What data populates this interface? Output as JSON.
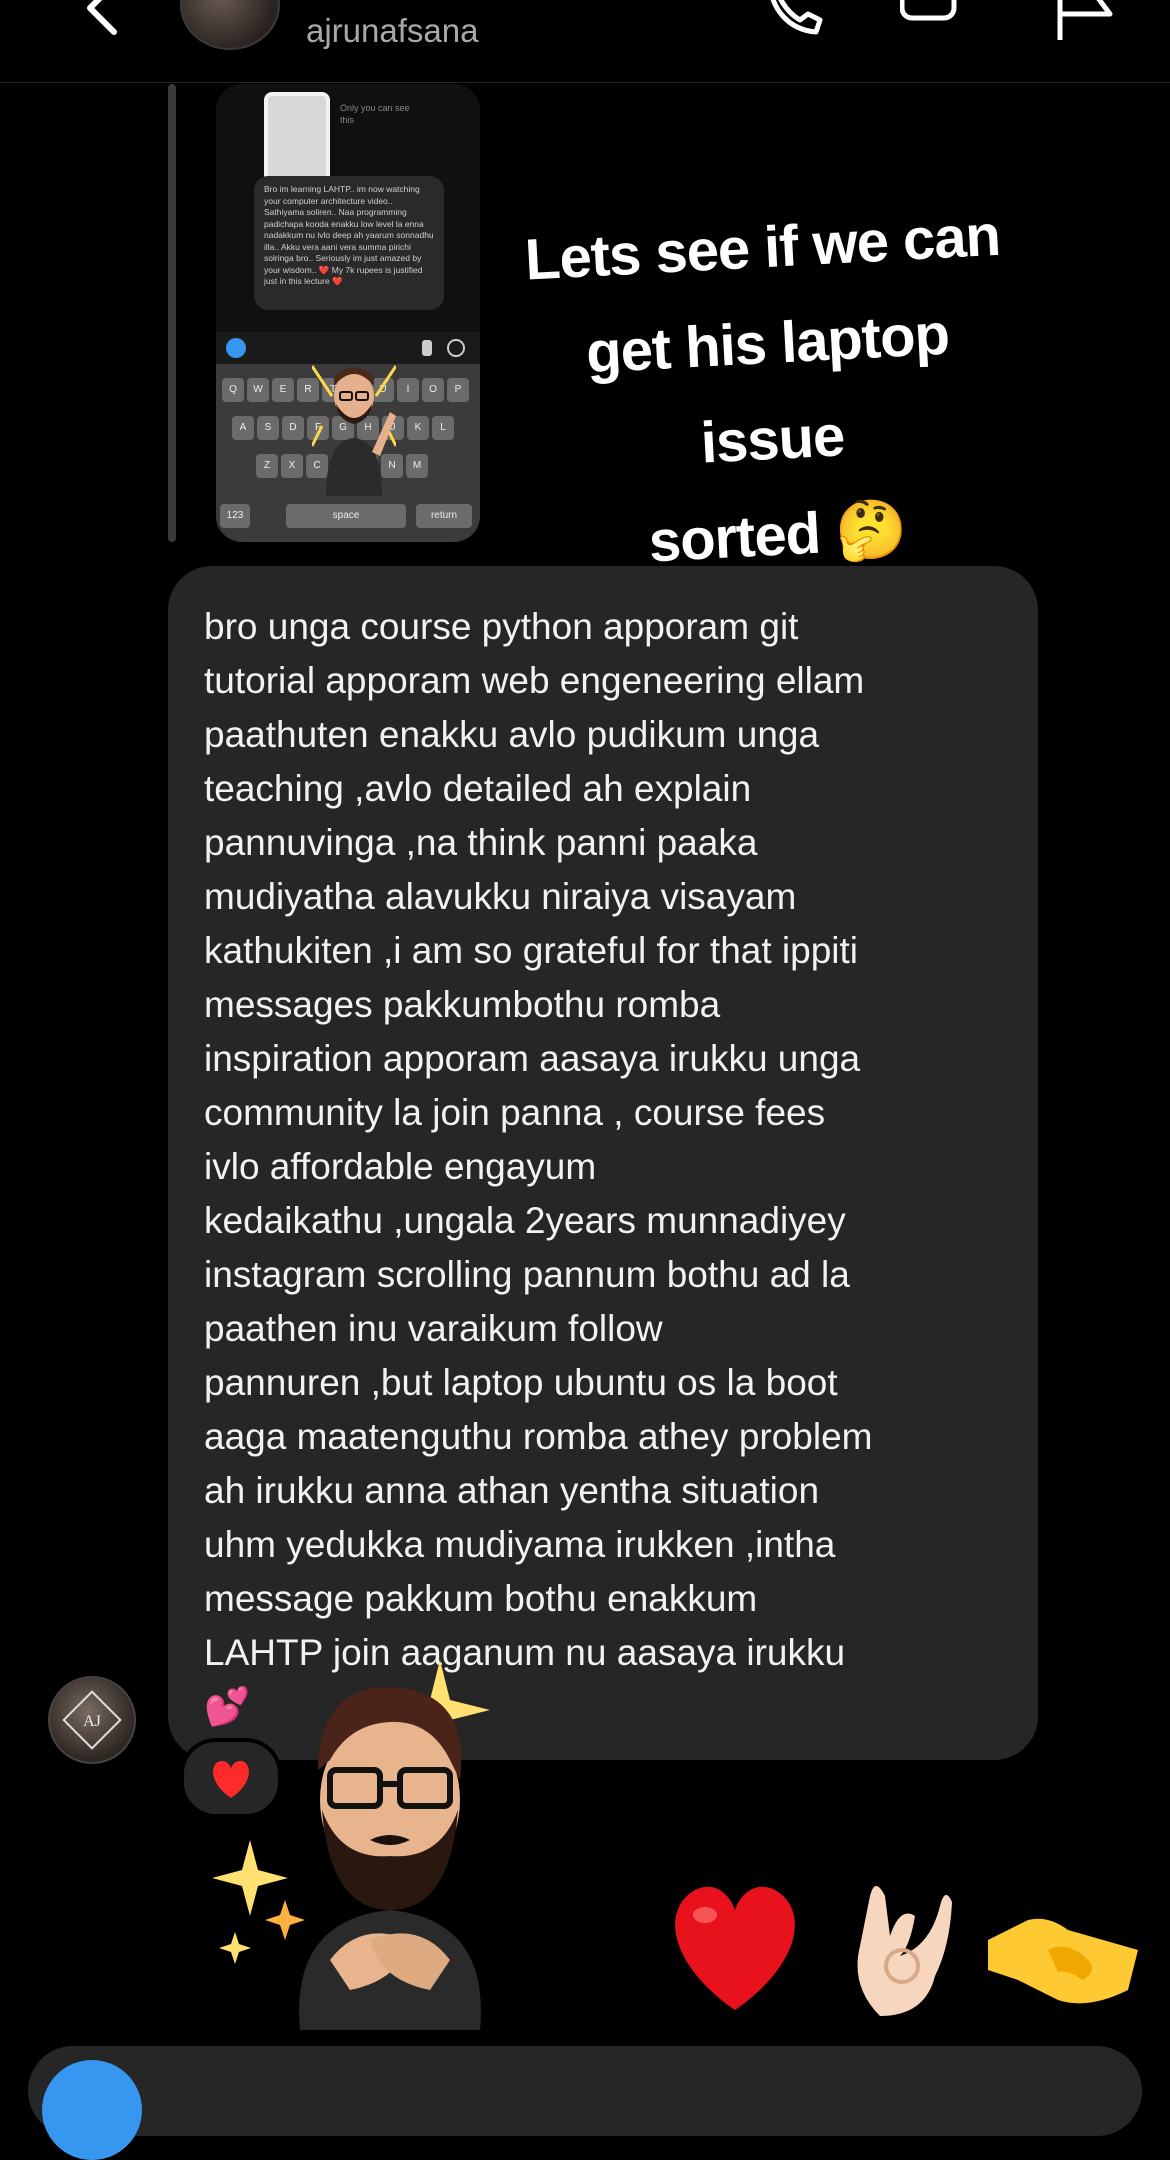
{
  "header": {
    "username": "ajrunafsana"
  },
  "story_reply": {
    "thumbnail": {
      "small_text": "Only you can see this",
      "quoted_message": "Bro im learning LAHTP.. im now watching your computer architecture video.. Sathiyama soliren.. Naa programming padichapa kooda enakku low level la enna nadakkum nu ivlo deep ah yaarum sonnadhu illa.. Akku vera aani vera summa pirichi solringa bro.. Seriously im just amazed by your wisdom.. ❤️ My 7k rupees is justified just in this lecture ❤️",
      "keyboard_row1": [
        "Q",
        "W",
        "E",
        "R",
        "T",
        "Y",
        "U",
        "I",
        "O",
        "P"
      ],
      "keyboard_row2": [
        "A",
        "S",
        "D",
        "F",
        "G",
        "H",
        "J",
        "K",
        "L"
      ],
      "keyboard_row3": [
        "Z",
        "X",
        "C",
        "V",
        "B",
        "N",
        "M"
      ],
      "key_123": "123",
      "key_space": "space",
      "key_return": "return"
    },
    "caption_line1": "Lets see if we can",
    "caption_line2": "get his laptop issue",
    "caption_line3": "sorted",
    "caption_emoji": "🤔"
  },
  "message": {
    "text": "bro unga course python apporam git\ntutorial apporam web engeneering ellam\npaathuten enakku avlo pudikum unga\nteaching ,avlo detailed ah explain\npannuvinga ,na think panni paaka\nmudiyatha alavukku niraiya visayam\nkathukiten ,i am so grateful for that ippiti\nmessages pakkumbothu romba\ninspiration apporam aasaya irukku unga\ncommunity la join panna , course fees\nivlo affordable engayum\nkedaikathu ,ungala 2years munnadiyey\ninstagram scrolling pannum bothu ad la\npaathen inu varaikum follow\npannuren ,but laptop ubuntu os la boot\naaga maatenguthu romba athey problem\nah irukku anna athan yentha situation\nuhm yedukka mudiyama irukken ,intha\nmessage pakkum bothu enakkum\nLAHTP join aaganum nu aasaya irukku\n💕",
    "reaction": "❤️",
    "sender_avatar_initials": "AJ"
  },
  "quick_reactions": {
    "heart": "heart-emoji",
    "ok": "ok-hand-emoji",
    "handshake": "handshake-emoji"
  },
  "colors": {
    "background": "#000000",
    "bubble": "#262626",
    "accent": "#3797f0",
    "username": "#a8a8a8"
  }
}
